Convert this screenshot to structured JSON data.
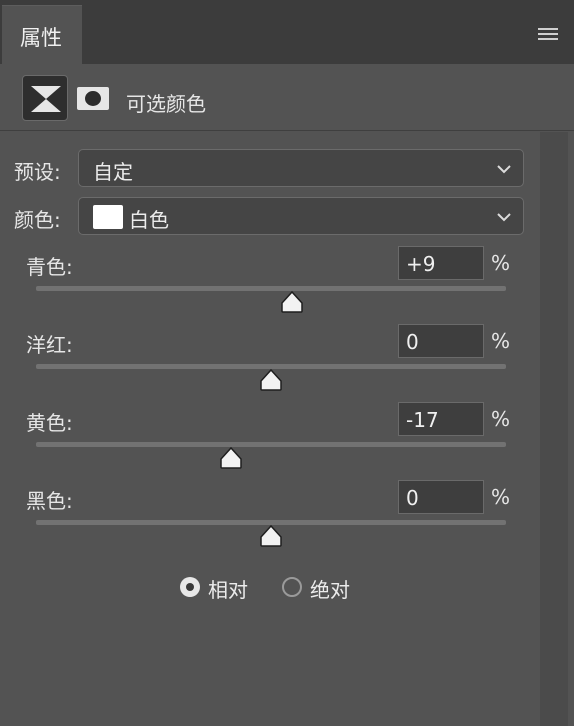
{
  "panel": {
    "tab_title": "属性",
    "menu_icon": "panel-menu-icon"
  },
  "adjustment": {
    "title": "可选颜色",
    "layer_icon": "selective-color-icon",
    "mask_icon": "layer-mask-icon"
  },
  "preset": {
    "label": "预设:",
    "value": "自定"
  },
  "colors": {
    "label": "颜色:",
    "value": "白色",
    "swatch_color": "#ffffff"
  },
  "sliders": [
    {
      "label": "青色:",
      "value": "+9",
      "unit": "%",
      "percent": 9
    },
    {
      "label": "洋红:",
      "value": "0",
      "unit": "%",
      "percent": 0
    },
    {
      "label": "黄色:",
      "value": "-17",
      "unit": "%",
      "percent": -17
    },
    {
      "label": "黑色:",
      "value": "0",
      "unit": "%",
      "percent": 0
    }
  ],
  "method": {
    "options": [
      {
        "label": "相对",
        "selected": true
      },
      {
        "label": "绝对",
        "selected": false
      }
    ]
  }
}
